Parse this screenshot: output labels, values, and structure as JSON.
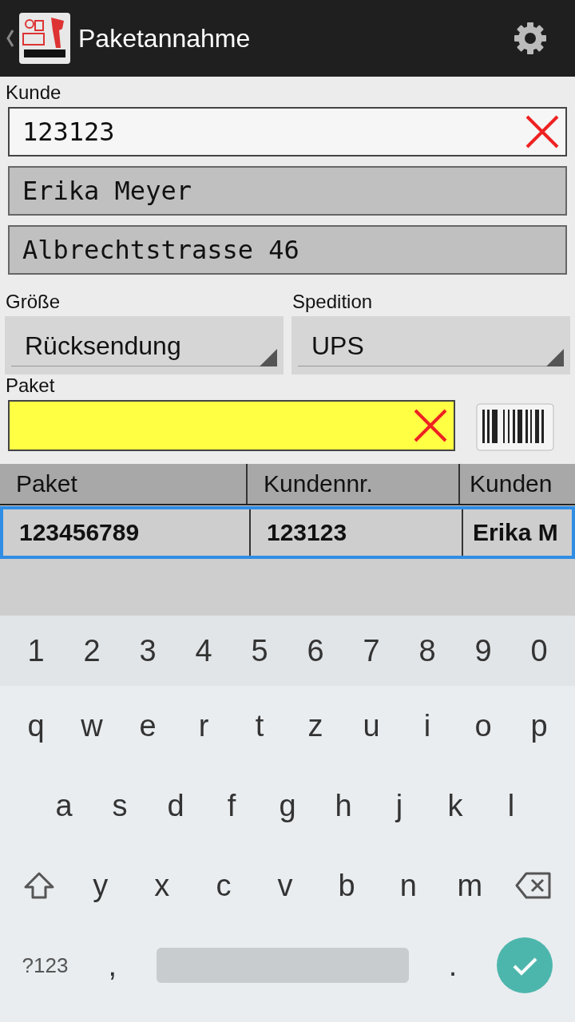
{
  "header": {
    "title": "Paketannahme"
  },
  "customer": {
    "label": "Kunde",
    "number": "123123",
    "name": "Erika Meyer",
    "street": "Albrechtstrasse 46"
  },
  "selects": [
    {
      "label": "Größe",
      "value": "Rücksendung"
    },
    {
      "label": "Spedition",
      "value": "UPS"
    }
  ],
  "package": {
    "label": "Paket"
  },
  "table": {
    "columns": [
      "Paket",
      "Kundennr.",
      "Kunden"
    ],
    "rows": [
      {
        "selected": true,
        "cells": [
          "123456789",
          "123123",
          "Erika M"
        ]
      }
    ]
  },
  "keyboard": {
    "rows": [
      [
        {
          "kind": "char",
          "label": "1"
        },
        {
          "kind": "char",
          "label": "2"
        },
        {
          "kind": "char",
          "label": "3"
        },
        {
          "kind": "char",
          "label": "4"
        },
        {
          "kind": "char",
          "label": "5"
        },
        {
          "kind": "char",
          "label": "6"
        },
        {
          "kind": "char",
          "label": "7"
        },
        {
          "kind": "char",
          "label": "8"
        },
        {
          "kind": "char",
          "label": "9"
        },
        {
          "kind": "char",
          "label": "0"
        }
      ],
      [
        {
          "kind": "char",
          "label": "q"
        },
        {
          "kind": "char",
          "label": "w"
        },
        {
          "kind": "char",
          "label": "e"
        },
        {
          "kind": "char",
          "label": "r"
        },
        {
          "kind": "char",
          "label": "t"
        },
        {
          "kind": "char",
          "label": "z"
        },
        {
          "kind": "char",
          "label": "u"
        },
        {
          "kind": "char",
          "label": "i"
        },
        {
          "kind": "char",
          "label": "o"
        },
        {
          "kind": "char",
          "label": "p"
        }
      ],
      [
        {
          "kind": "char",
          "label": "a"
        },
        {
          "kind": "char",
          "label": "s"
        },
        {
          "kind": "char",
          "label": "d"
        },
        {
          "kind": "char",
          "label": "f"
        },
        {
          "kind": "char",
          "label": "g"
        },
        {
          "kind": "char",
          "label": "h"
        },
        {
          "kind": "char",
          "label": "j"
        },
        {
          "kind": "char",
          "label": "k"
        },
        {
          "kind": "char",
          "label": "l"
        }
      ],
      [
        {
          "kind": "shift"
        },
        {
          "kind": "char",
          "label": "y"
        },
        {
          "kind": "char",
          "label": "x"
        },
        {
          "kind": "char",
          "label": "c"
        },
        {
          "kind": "char",
          "label": "v"
        },
        {
          "kind": "char",
          "label": "b"
        },
        {
          "kind": "char",
          "label": "n"
        },
        {
          "kind": "char",
          "label": "m"
        },
        {
          "kind": "backspace"
        }
      ],
      [
        {
          "kind": "mode",
          "label": "?123"
        },
        {
          "kind": "char",
          "label": ","
        },
        {
          "kind": "space"
        },
        {
          "kind": "char",
          "label": "."
        },
        {
          "kind": "enter"
        }
      ]
    ]
  }
}
